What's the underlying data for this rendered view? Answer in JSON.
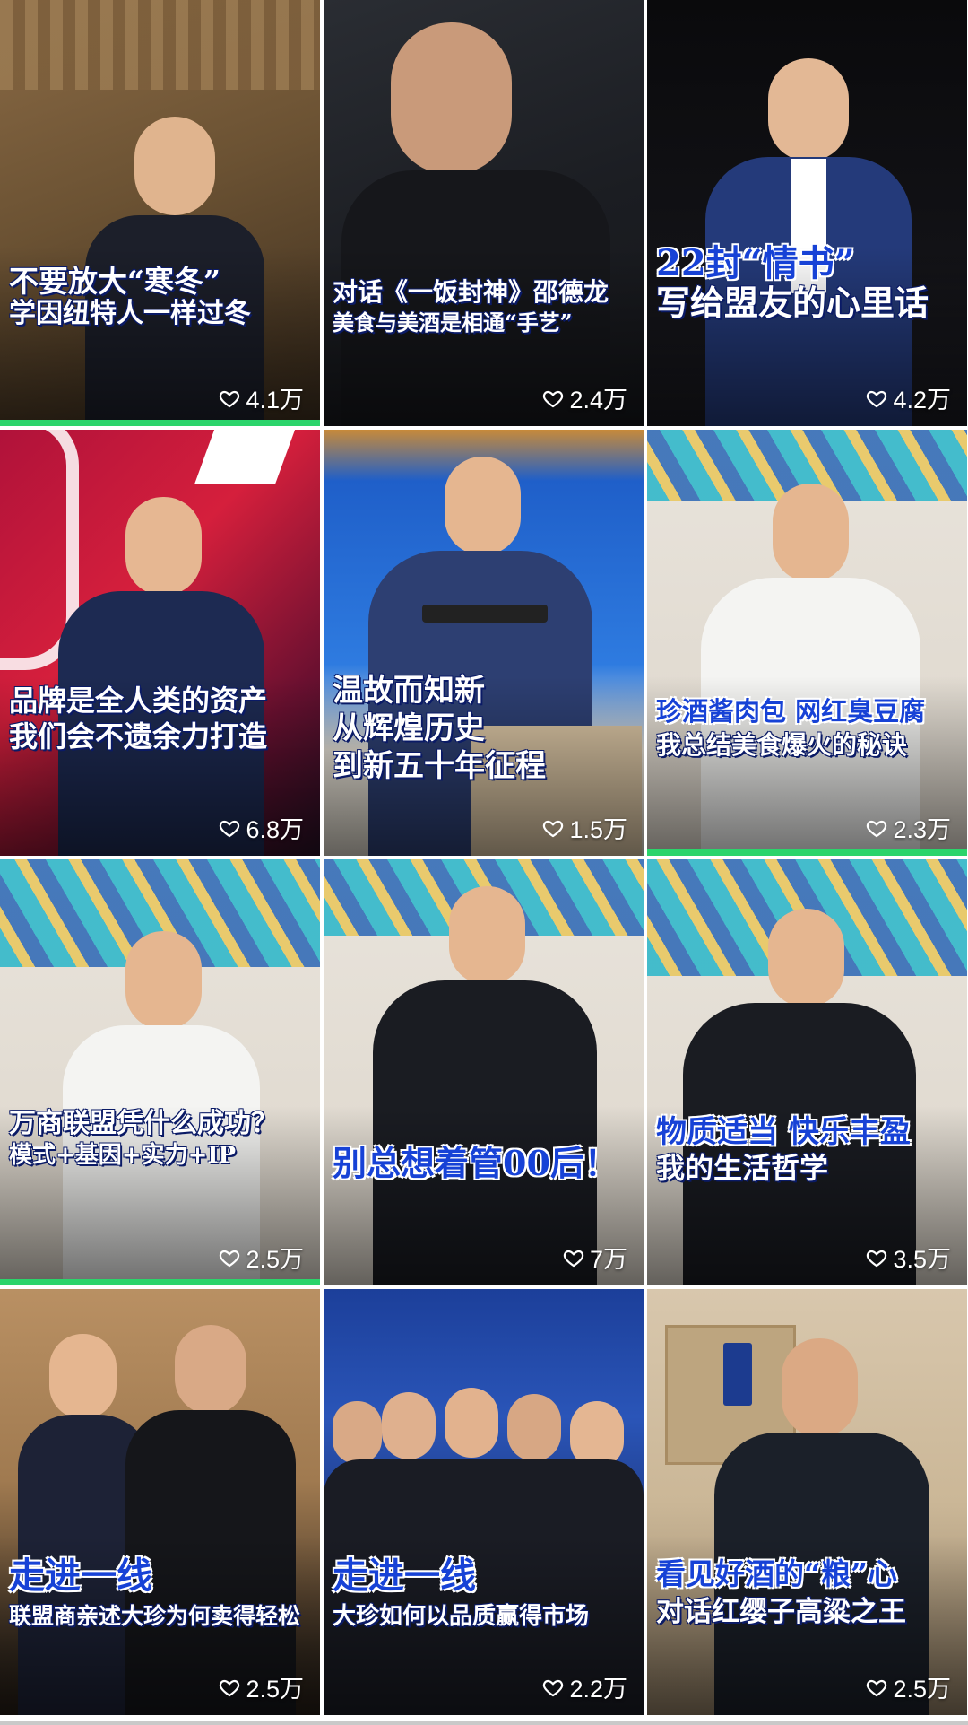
{
  "colors": {
    "accent_green": "#2bd46b",
    "title_blue": "#1742d6",
    "text_white": "#ffffff"
  },
  "icons": {
    "like": "heart-outline-icon"
  },
  "videos": [
    {
      "title_line1": "不要放大“寒冬”",
      "title_line2": "学因纽特人一样过冬",
      "likes": "4.1万"
    },
    {
      "title_line1": "对话《一饭封神》邵德龙",
      "title_line2": "美食与美酒是相通“手艺”",
      "likes": "2.4万"
    },
    {
      "title_line1": "22封“情书”",
      "title_line2": "写给盟友的心里话",
      "likes": "4.2万"
    },
    {
      "title_line1": "品牌是全人类的资产",
      "title_line2": "我们会不遗余力打造",
      "likes": "6.8万"
    },
    {
      "title_line1": "温故而知新",
      "title_line2": "从辉煌历史",
      "title_line3": "到新五十年征程",
      "likes": "1.5万"
    },
    {
      "title_line1": "珍酒酱肉包 网红臭豆腐",
      "title_line2": "我总结美食爆火的秘诀",
      "likes": "2.3万"
    },
    {
      "title_line1": "万商联盟凭什么成功？",
      "title_line2": "模式+基因+实力+IP",
      "likes": "2.5万"
    },
    {
      "title_line1": "别总想着管00后！",
      "likes": "7万"
    },
    {
      "title_line1": "物质适当 快乐丰盈",
      "title_line2": "我的生活哲学",
      "likes": "3.5万"
    },
    {
      "title_line1": "走进一线",
      "title_line2": "联盟商亲述大珍为何卖得轻松",
      "likes": "2.5万"
    },
    {
      "title_line1": "走进一线",
      "title_line2": "大珍如何以品质赢得市场",
      "likes": "2.2万"
    },
    {
      "title_line1": "看见好酒的“粮”心",
      "title_line2": "对话红缨子高粱之王",
      "likes": "2.5万"
    }
  ]
}
